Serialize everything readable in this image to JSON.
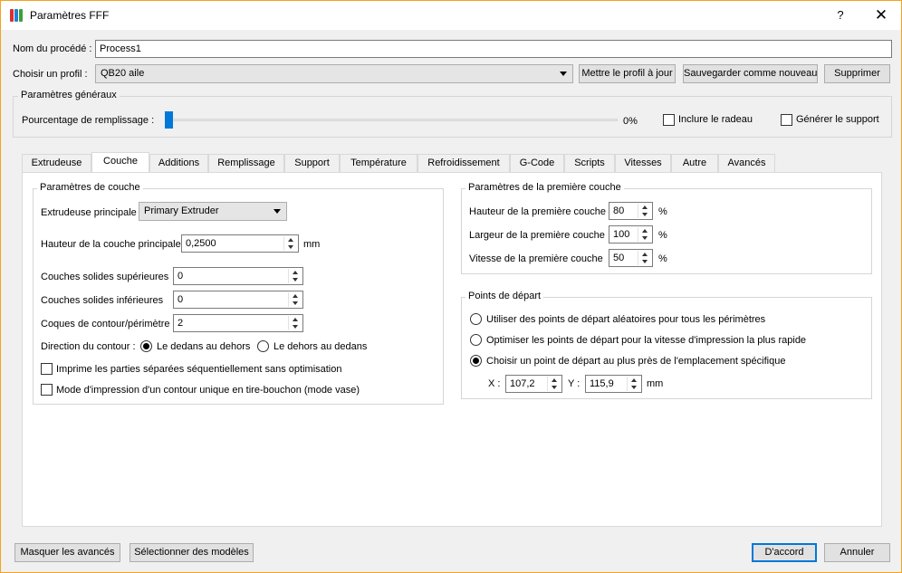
{
  "window": {
    "title": "Paramètres FFF",
    "help": "?",
    "close": "✕"
  },
  "process": {
    "name_label": "Nom du procédé :",
    "name_value": "Process1"
  },
  "profile": {
    "label": "Choisir un profil :",
    "value": "QB20 aile",
    "update_button": "Mettre le profil à jour",
    "save_new_button": "Sauvegarder comme nouveau",
    "delete_button": "Supprimer"
  },
  "general": {
    "title": "Paramètres généraux",
    "infill_label": "Pourcentage de remplissage :",
    "infill_value": "0%",
    "infill_fraction": 0,
    "raft_label": "Inclure le radeau",
    "raft_checked": false,
    "support_label": "Générer le support",
    "support_checked": false
  },
  "tabs": [
    {
      "label": "Extrudeuse"
    },
    {
      "label": "Couche",
      "active": true
    },
    {
      "label": "Additions"
    },
    {
      "label": "Remplissage"
    },
    {
      "label": "Support"
    },
    {
      "label": "Température"
    },
    {
      "label": "Refroidissement"
    },
    {
      "label": "G-Code"
    },
    {
      "label": "Scripts"
    },
    {
      "label": "Vitesses"
    },
    {
      "label": "Autre"
    },
    {
      "label": "Avancés"
    }
  ],
  "layer": {
    "title": "Paramètres de couche",
    "main_extruder_label": "Extrudeuse principale",
    "main_extruder_value": "Primary Extruder",
    "layer_height_label": "Hauteur de la couche principale",
    "layer_height_value": "0,2500",
    "layer_height_unit": "mm",
    "top_solid_label": "Couches solides supérieures",
    "top_solid_value": "0",
    "bottom_solid_label": "Couches solides inférieures",
    "bottom_solid_value": "0",
    "perimeter_label": "Coques de contour/périmètre",
    "perimeter_value": "2",
    "direction_label": "Direction du contour :",
    "direction_inside_out": "Le dedans au dehors",
    "direction_outside_in": "Le dehors au dedans",
    "sequential_label": "Imprime les parties séparées séquentiellement sans optimisation",
    "vase_label": "Mode d'impression d'un contour unique en tire-bouchon (mode vase)"
  },
  "first_layer": {
    "title": "Paramètres de la première couche",
    "height_label": "Hauteur de la première couche",
    "height_value": "80",
    "width_label": "Largeur de la première couche",
    "width_value": "100",
    "speed_label": "Vitesse de la première couche",
    "speed_value": "50",
    "unit": "%"
  },
  "start_points": {
    "title": "Points de départ",
    "random_label": "Utiliser des points de départ aléatoires pour tous les périmètres",
    "optimize_label": "Optimiser les points de départ pour la vitesse d'impression la plus rapide",
    "specific_label": "Choisir un point de départ au plus près de l'emplacement spécifique",
    "x_label": "X :",
    "x_value": "107,2",
    "y_label": "Y :",
    "y_value": "115,9",
    "unit": "mm"
  },
  "footer": {
    "hide_advanced": "Masquer les avancés",
    "select_models": "Sélectionner des modèles",
    "ok": "D'accord",
    "cancel": "Annuler"
  },
  "colors": {
    "accent": "#0078d7",
    "window_border": "#f4a21c"
  }
}
